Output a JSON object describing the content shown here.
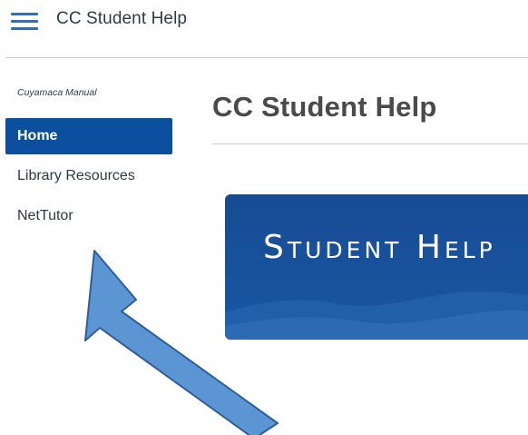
{
  "header": {
    "menu_icon": "hamburger-menu-icon",
    "title": "CC Student Help"
  },
  "sidebar": {
    "course_label": "Cuyamaca Manual",
    "items": [
      {
        "label": "Home",
        "active": true
      },
      {
        "label": "Library Resources",
        "active": false
      },
      {
        "label": "NetTutor",
        "active": false
      }
    ]
  },
  "main": {
    "title": "CC Student Help",
    "banner_text": "Student Help"
  },
  "colors": {
    "accent": "#0b4f9e",
    "hamburger": "#2f6fb4",
    "banner": "#1a56a4",
    "arrow_fill": "#5b95d4",
    "arrow_stroke": "#2e5f99"
  }
}
